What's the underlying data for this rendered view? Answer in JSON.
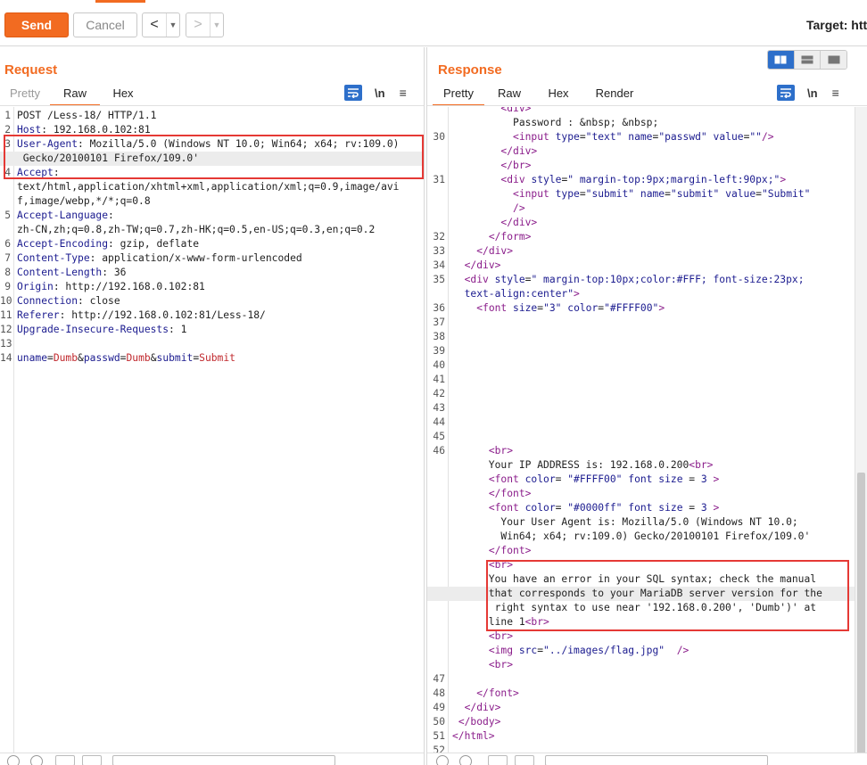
{
  "toolbar": {
    "send_label": "Send",
    "cancel_label": "Cancel",
    "back_glyph": "<",
    "forward_glyph": ">",
    "dropdown_glyph": "▼",
    "target_label": "Target: htt"
  },
  "request": {
    "title": "Request",
    "tabs": [
      {
        "label": "Pretty",
        "state": "muted"
      },
      {
        "label": "Raw",
        "state": "active"
      },
      {
        "label": "Hex",
        "state": "normal"
      }
    ],
    "newline_label": "\\n",
    "menu_glyph": "≡",
    "lines": [
      {
        "n": "1",
        "parts": [
          [
            "",
            "POST /Less-18/ HTTP/1.1"
          ]
        ]
      },
      {
        "n": "2",
        "parts": [
          [
            "k",
            "Host"
          ],
          [
            "",
            ": 192.168.0.102:81"
          ]
        ]
      },
      {
        "n": "3",
        "parts": [
          [
            "k",
            "User-Agent"
          ],
          [
            "",
            ": Mozilla/5.0 (Windows NT 10.0; Win64; x64; rv:109.0)"
          ]
        ]
      },
      {
        "n": "",
        "hl": true,
        "parts": [
          [
            "",
            " Gecko/20100101 Firefox/109.0'"
          ]
        ]
      },
      {
        "n": "4",
        "parts": [
          [
            "k",
            "Accept"
          ],
          [
            "",
            ":"
          ]
        ]
      },
      {
        "n": "",
        "parts": [
          [
            "",
            "text/html,application/xhtml+xml,application/xml;q=0.9,image/avi"
          ]
        ]
      },
      {
        "n": "",
        "parts": [
          [
            "",
            "f,image/webp,*/*;q=0.8"
          ]
        ]
      },
      {
        "n": "5",
        "parts": [
          [
            "k",
            "Accept-Language"
          ],
          [
            "",
            ":"
          ]
        ]
      },
      {
        "n": "",
        "parts": [
          [
            "",
            "zh-CN,zh;q=0.8,zh-TW;q=0.7,zh-HK;q=0.5,en-US;q=0.3,en;q=0.2"
          ]
        ]
      },
      {
        "n": "6",
        "parts": [
          [
            "k",
            "Accept-Encoding"
          ],
          [
            "",
            ": gzip, deflate"
          ]
        ]
      },
      {
        "n": "7",
        "parts": [
          [
            "k",
            "Content-Type"
          ],
          [
            "",
            ": application/x-www-form-urlencoded"
          ]
        ]
      },
      {
        "n": "8",
        "parts": [
          [
            "k",
            "Content-Length"
          ],
          [
            "",
            ": 36"
          ]
        ]
      },
      {
        "n": "9",
        "parts": [
          [
            "k",
            "Origin"
          ],
          [
            "",
            ": http://192.168.0.102:81"
          ]
        ]
      },
      {
        "n": "10",
        "parts": [
          [
            "k",
            "Connection"
          ],
          [
            "",
            ": close"
          ]
        ]
      },
      {
        "n": "11",
        "parts": [
          [
            "k",
            "Referer"
          ],
          [
            "",
            ": http://192.168.0.102:81/Less-18/"
          ]
        ]
      },
      {
        "n": "12",
        "parts": [
          [
            "k",
            "Upgrade-Insecure-Requests"
          ],
          [
            "",
            ": 1"
          ]
        ]
      },
      {
        "n": "13",
        "parts": [
          [
            "",
            ""
          ]
        ]
      },
      {
        "n": "14",
        "parts": [
          [
            "k",
            "uname"
          ],
          [
            "",
            "="
          ],
          [
            "red",
            "Dumb"
          ],
          [
            "",
            "&"
          ],
          [
            "k",
            "passwd"
          ],
          [
            "",
            "="
          ],
          [
            "red",
            "Dumb"
          ],
          [
            "",
            "&"
          ],
          [
            "k",
            "submit"
          ],
          [
            "",
            "="
          ],
          [
            "red",
            "Submit"
          ]
        ]
      }
    ]
  },
  "response": {
    "title": "Response",
    "tabs": [
      {
        "label": "Pretty",
        "state": "active"
      },
      {
        "label": "Raw",
        "state": "normal"
      },
      {
        "label": "Hex",
        "state": "normal"
      },
      {
        "label": "Render",
        "state": "normal"
      }
    ],
    "newline_label": "\\n",
    "menu_glyph": "≡",
    "lines": [
      {
        "n": "",
        "parts": [
          [
            "",
            "        "
          ],
          [
            "tag",
            "<div>"
          ]
        ]
      },
      {
        "n": "",
        "parts": [
          [
            "",
            "          Password : &nbsp; &nbsp;"
          ]
        ]
      },
      {
        "n": "30",
        "parts": [
          [
            "",
            "          "
          ],
          [
            "tag",
            "<input "
          ],
          [
            "attr",
            "type"
          ],
          [
            "",
            "="
          ],
          [
            "str",
            "\"text\""
          ],
          [
            "",
            " "
          ],
          [
            "attr",
            "name"
          ],
          [
            "",
            "="
          ],
          [
            "str",
            "\"passwd\""
          ],
          [
            "",
            " "
          ],
          [
            "attr",
            "value"
          ],
          [
            "",
            "="
          ],
          [
            "str",
            "\"\""
          ],
          [
            "tag",
            "/>"
          ]
        ]
      },
      {
        "n": "",
        "parts": [
          [
            "",
            "        "
          ],
          [
            "tag",
            "</div>"
          ]
        ]
      },
      {
        "n": "",
        "parts": [
          [
            "",
            "        "
          ],
          [
            "tag",
            "</br>"
          ]
        ]
      },
      {
        "n": "31",
        "parts": [
          [
            "",
            "        "
          ],
          [
            "tag",
            "<div "
          ],
          [
            "attr",
            "style"
          ],
          [
            "",
            "="
          ],
          [
            "str",
            "\" margin-top:9px;margin-left:90px;\""
          ],
          [
            "tag",
            ">"
          ]
        ]
      },
      {
        "n": "",
        "parts": [
          [
            "",
            "          "
          ],
          [
            "tag",
            "<input "
          ],
          [
            "attr",
            "type"
          ],
          [
            "",
            "="
          ],
          [
            "str",
            "\"submit\""
          ],
          [
            "",
            " "
          ],
          [
            "attr",
            "name"
          ],
          [
            "",
            "="
          ],
          [
            "str",
            "\"submit\""
          ],
          [
            "",
            " "
          ],
          [
            "attr",
            "value"
          ],
          [
            "",
            "="
          ],
          [
            "str",
            "\"Submit\""
          ]
        ]
      },
      {
        "n": "",
        "parts": [
          [
            "",
            "          "
          ],
          [
            "tag",
            "/>"
          ]
        ]
      },
      {
        "n": "",
        "parts": [
          [
            "",
            "        "
          ],
          [
            "tag",
            "</div>"
          ]
        ]
      },
      {
        "n": "32",
        "parts": [
          [
            "",
            "      "
          ],
          [
            "tag",
            "</form>"
          ]
        ]
      },
      {
        "n": "33",
        "parts": [
          [
            "",
            "    "
          ],
          [
            "tag",
            "</div>"
          ]
        ]
      },
      {
        "n": "34",
        "parts": [
          [
            "",
            "  "
          ],
          [
            "tag",
            "</div>"
          ]
        ]
      },
      {
        "n": "35",
        "parts": [
          [
            "",
            "  "
          ],
          [
            "tag",
            "<div "
          ],
          [
            "attr",
            "style"
          ],
          [
            "",
            "="
          ],
          [
            "str",
            "\" margin-top:10px;color:#FFF; font-size:23px;"
          ]
        ]
      },
      {
        "n": "",
        "parts": [
          [
            "str",
            "  text-align:center\""
          ],
          [
            "tag",
            ">"
          ]
        ]
      },
      {
        "n": "36",
        "parts": [
          [
            "",
            "    "
          ],
          [
            "tag",
            "<font "
          ],
          [
            "attr",
            "size"
          ],
          [
            "",
            "="
          ],
          [
            "str",
            "\"3\""
          ],
          [
            "",
            " "
          ],
          [
            "attr",
            "color"
          ],
          [
            "",
            "="
          ],
          [
            "str",
            "\"#FFFF00\""
          ],
          [
            "tag",
            ">"
          ]
        ]
      },
      {
        "n": "37",
        "parts": [
          [
            "",
            ""
          ]
        ]
      },
      {
        "n": "38",
        "parts": [
          [
            "",
            ""
          ]
        ]
      },
      {
        "n": "39",
        "parts": [
          [
            "",
            ""
          ]
        ]
      },
      {
        "n": "40",
        "parts": [
          [
            "",
            ""
          ]
        ]
      },
      {
        "n": "41",
        "parts": [
          [
            "",
            ""
          ]
        ]
      },
      {
        "n": "42",
        "parts": [
          [
            "",
            ""
          ]
        ]
      },
      {
        "n": "43",
        "parts": [
          [
            "",
            ""
          ]
        ]
      },
      {
        "n": "44",
        "parts": [
          [
            "",
            ""
          ]
        ]
      },
      {
        "n": "45",
        "parts": [
          [
            "",
            ""
          ]
        ]
      },
      {
        "n": "46",
        "parts": [
          [
            "",
            "      "
          ],
          [
            "tag",
            "<br>"
          ]
        ]
      },
      {
        "n": "",
        "parts": [
          [
            "",
            "      Your IP ADDRESS is: 192.168.0.200"
          ],
          [
            "tag",
            "<br>"
          ]
        ]
      },
      {
        "n": "",
        "parts": [
          [
            "",
            "      "
          ],
          [
            "tag",
            "<font "
          ],
          [
            "attr",
            "color"
          ],
          [
            "",
            "= "
          ],
          [
            "str",
            "\"#FFFF00\""
          ],
          [
            "",
            " "
          ],
          [
            "attr",
            "font size"
          ],
          [
            "",
            " = "
          ],
          [
            "str",
            "3"
          ],
          [
            "",
            " "
          ],
          [
            "tag",
            ">"
          ]
        ]
      },
      {
        "n": "",
        "parts": [
          [
            "",
            "      "
          ],
          [
            "tag",
            "</font>"
          ]
        ]
      },
      {
        "n": "",
        "parts": [
          [
            "",
            "      "
          ],
          [
            "tag",
            "<font "
          ],
          [
            "attr",
            "color"
          ],
          [
            "",
            "= "
          ],
          [
            "str",
            "\"#0000ff\""
          ],
          [
            "",
            " "
          ],
          [
            "attr",
            "font size"
          ],
          [
            "",
            " = "
          ],
          [
            "str",
            "3"
          ],
          [
            "",
            " "
          ],
          [
            "tag",
            ">"
          ]
        ]
      },
      {
        "n": "",
        "parts": [
          [
            "",
            "        Your User Agent is: Mozilla/5.0 (Windows NT 10.0;"
          ]
        ]
      },
      {
        "n": "",
        "parts": [
          [
            "",
            "        Win64; x64; rv:109.0) Gecko/20100101 Firefox/109.0'"
          ]
        ]
      },
      {
        "n": "",
        "parts": [
          [
            "",
            "      "
          ],
          [
            "tag",
            "</font>"
          ]
        ]
      },
      {
        "n": "",
        "parts": [
          [
            "",
            "      "
          ],
          [
            "tag",
            "<br>"
          ]
        ]
      },
      {
        "n": "",
        "parts": [
          [
            "",
            "      You have an error in your SQL syntax; check the manual"
          ]
        ]
      },
      {
        "n": "",
        "hl": true,
        "parts": [
          [
            "",
            "      that corresponds to your MariaDB server version for the"
          ]
        ]
      },
      {
        "n": "",
        "parts": [
          [
            "",
            "       right syntax to use near '192.168.0.200', 'Dumb')' at"
          ]
        ]
      },
      {
        "n": "",
        "parts": [
          [
            "",
            "      line 1"
          ],
          [
            "tag",
            "<br>"
          ]
        ]
      },
      {
        "n": "",
        "parts": [
          [
            "",
            "      "
          ],
          [
            "tag",
            "<br>"
          ]
        ]
      },
      {
        "n": "",
        "parts": [
          [
            "",
            "      "
          ],
          [
            "tag",
            "<img "
          ],
          [
            "attr",
            "src"
          ],
          [
            "",
            "="
          ],
          [
            "str",
            "\"../images/flag.jpg\""
          ],
          [
            "",
            "  "
          ],
          [
            "tag",
            "/>"
          ]
        ]
      },
      {
        "n": "",
        "parts": [
          [
            "",
            "      "
          ],
          [
            "tag",
            "<br>"
          ]
        ]
      },
      {
        "n": "47",
        "parts": [
          [
            "",
            ""
          ]
        ]
      },
      {
        "n": "48",
        "parts": [
          [
            "",
            "    "
          ],
          [
            "tag",
            "</font>"
          ]
        ]
      },
      {
        "n": "49",
        "parts": [
          [
            "",
            "  "
          ],
          [
            "tag",
            "</div>"
          ]
        ]
      },
      {
        "n": "50",
        "parts": [
          [
            "",
            " "
          ],
          [
            "tag",
            "</body>"
          ]
        ]
      },
      {
        "n": "51",
        "parts": [
          [
            "tag",
            "</html>"
          ]
        ]
      },
      {
        "n": "52",
        "parts": [
          [
            "",
            ""
          ]
        ]
      }
    ]
  },
  "colors": {
    "accent": "#f26b21",
    "highlight_box": "#e53935",
    "tool_blue": "#2d6fca"
  },
  "icons": {
    "wrap": "wrap-lines-icon",
    "menu": "hamburger-menu-icon",
    "view_split": "split-view-icon",
    "view_horizontal": "horizontal-view-icon",
    "view_single": "single-view-icon"
  }
}
